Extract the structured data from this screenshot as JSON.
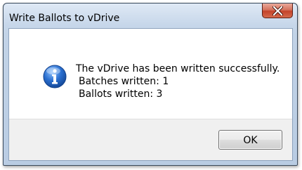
{
  "window": {
    "title": "Write Ballots to vDrive",
    "close_icon": "close-x-icon"
  },
  "message": {
    "icon": "information-icon",
    "line1": "The vDrive has been written successfully.",
    "line2": "Batches written: 1",
    "line3": "Ballots written: 3"
  },
  "buttons": {
    "ok_label": "OK"
  },
  "colors": {
    "close_button": "#c4432a",
    "info_icon": "#2a6fd0",
    "footer": "#f0f0f0"
  }
}
